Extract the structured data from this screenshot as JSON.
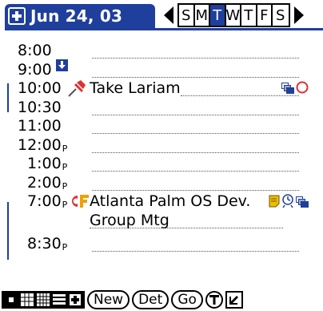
{
  "header": {
    "date_title": "Jun 24, 03",
    "week_days": [
      "S",
      "M",
      "T",
      "W",
      "T",
      "F",
      "S"
    ],
    "active_day_index": 2
  },
  "rows": [
    {
      "time": "8:00",
      "pm": "",
      "desc": ""
    },
    {
      "time": "9:00",
      "pm": "",
      "desc": ""
    },
    {
      "time": "10:00",
      "pm": "",
      "desc": "Take Lariam"
    },
    {
      "time": "10:30",
      "pm": "",
      "desc": ""
    },
    {
      "time": "11:00",
      "pm": "",
      "desc": ""
    },
    {
      "time": "12:00",
      "pm": "P",
      "desc": ""
    },
    {
      "time": "1:00",
      "pm": "P",
      "desc": ""
    },
    {
      "time": "2:00",
      "pm": "P",
      "desc": ""
    },
    {
      "time": "7:00",
      "pm": "P",
      "desc": "Atlanta Palm OS Dev."
    },
    {
      "time": "",
      "pm": "",
      "desc": "Group Mtg"
    },
    {
      "time": "8:30",
      "pm": "P",
      "desc": ""
    }
  ],
  "toolbar": {
    "new_label": "New",
    "details_label": "Det",
    "go_label": "Go"
  },
  "colors": {
    "accent": "#1f3f9d",
    "alarm": "#e03030",
    "category": "#f0a000",
    "note": "#e8c000"
  }
}
